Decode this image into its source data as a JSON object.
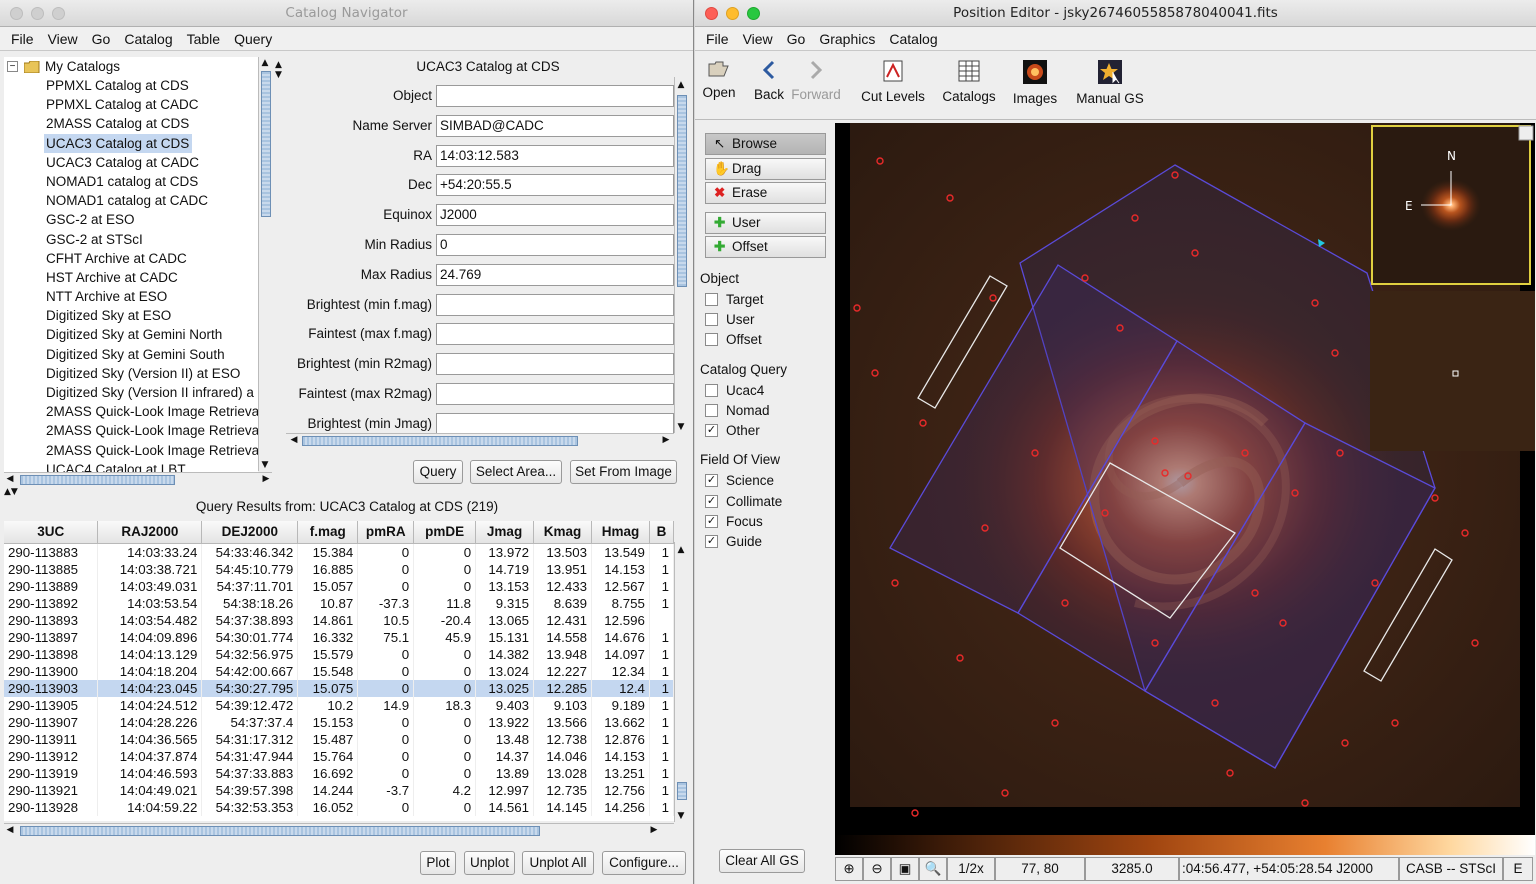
{
  "left_window": {
    "title": "Catalog Navigator",
    "menu": [
      "File",
      "View",
      "Go",
      "Catalog",
      "Table",
      "Query"
    ],
    "tree": {
      "root": "My Catalogs",
      "items": [
        "PPMXL Catalog at CDS",
        "PPMXL Catalog at CADC",
        "2MASS Catalog at CDS",
        "UCAC3 Catalog at CDS",
        "UCAC3 Catalog at CADC",
        "NOMAD1 catalog at CDS",
        "NOMAD1 catalog at CADC",
        "GSC-2 at ESO",
        "GSC-2 at STScI",
        "CFHT Archive at CADC",
        "HST Archive at CADC",
        "NTT Archive at ESO",
        "Digitized Sky at ESO",
        "Digitized Sky at Gemini North",
        "Digitized Sky at Gemini South",
        "Digitized Sky (Version II) at ESO",
        "Digitized Sky (Version II infrared) a",
        "2MASS Quick-Look Image Retrieva",
        "2MASS Quick-Look Image Retrieva",
        "2MASS Quick-Look Image Retrieva",
        "UCAC4 Catalog at LBT"
      ],
      "selected_index": 3
    },
    "form": {
      "title": "UCAC3 Catalog at CDS",
      "fields": [
        {
          "label": "Object",
          "value": ""
        },
        {
          "label": "Name Server",
          "value": "SIMBAD@CADC"
        },
        {
          "label": "RA",
          "value": "14:03:12.583"
        },
        {
          "label": "Dec",
          "value": "+54:20:55.5"
        },
        {
          "label": "Equinox",
          "value": "J2000"
        },
        {
          "label": "Min Radius",
          "value": "0"
        },
        {
          "label": "Max Radius",
          "value": "24.769"
        },
        {
          "label": "Brightest (min f.mag)",
          "value": ""
        },
        {
          "label": "Faintest (max f.mag)",
          "value": ""
        },
        {
          "label": "Brightest (min R2mag)",
          "value": ""
        },
        {
          "label": "Faintest (max R2mag)",
          "value": ""
        },
        {
          "label": "Brightest (min Jmag)",
          "value": ""
        }
      ],
      "buttons": {
        "query": "Query",
        "select_area": "Select Area...",
        "set_from_image": "Set From Image"
      }
    },
    "results": {
      "title": "Query Results from: UCAC3 Catalog at CDS (219)",
      "columns": [
        "3UC",
        "RAJ2000",
        "DEJ2000",
        "f.mag",
        "pmRA",
        "pmDE",
        "Jmag",
        "Kmag",
        "Hmag",
        "B"
      ],
      "rows": [
        [
          "290-113883",
          "14:03:33.24",
          "54:33:46.342",
          "15.384",
          "0",
          "0",
          "13.972",
          "13.503",
          "13.549",
          "1"
        ],
        [
          "290-113885",
          "14:03:38.721",
          "54:45:10.779",
          "16.885",
          "0",
          "0",
          "14.719",
          "13.951",
          "14.153",
          "1"
        ],
        [
          "290-113889",
          "14:03:49.031",
          "54:37:11.701",
          "15.057",
          "0",
          "0",
          "13.153",
          "12.433",
          "12.567",
          "1"
        ],
        [
          "290-113892",
          "14:03:53.54",
          "54:38:18.26",
          "10.87",
          "-37.3",
          "11.8",
          "9.315",
          "8.639",
          "8.755",
          "1"
        ],
        [
          "290-113893",
          "14:03:54.482",
          "54:37:38.893",
          "14.861",
          "10.5",
          "-20.4",
          "13.065",
          "12.431",
          "12.596",
          ""
        ],
        [
          "290-113897",
          "14:04:09.896",
          "54:30:01.774",
          "16.332",
          "75.1",
          "45.9",
          "15.131",
          "14.558",
          "14.676",
          "1"
        ],
        [
          "290-113898",
          "14:04:13.129",
          "54:32:56.975",
          "15.579",
          "0",
          "0",
          "14.382",
          "13.948",
          "14.097",
          "1"
        ],
        [
          "290-113900",
          "14:04:18.204",
          "54:42:00.667",
          "15.548",
          "0",
          "0",
          "13.024",
          "12.227",
          "12.34",
          "1"
        ],
        [
          "290-113903",
          "14:04:23.045",
          "54:30:27.795",
          "15.075",
          "0",
          "0",
          "13.025",
          "12.285",
          "12.4",
          "1"
        ],
        [
          "290-113905",
          "14:04:24.512",
          "54:39:12.472",
          "10.2",
          "14.9",
          "18.3",
          "9.403",
          "9.103",
          "9.189",
          "1"
        ],
        [
          "290-113907",
          "14:04:28.226",
          "54:37:37.4",
          "15.153",
          "0",
          "0",
          "13.922",
          "13.566",
          "13.662",
          "1"
        ],
        [
          "290-113911",
          "14:04:36.565",
          "54:31:17.312",
          "15.487",
          "0",
          "0",
          "13.48",
          "12.738",
          "12.876",
          "1"
        ],
        [
          "290-113912",
          "14:04:37.874",
          "54:31:47.944",
          "15.764",
          "0",
          "0",
          "14.37",
          "14.046",
          "14.153",
          "1"
        ],
        [
          "290-113919",
          "14:04:46.593",
          "54:37:33.883",
          "16.692",
          "0",
          "0",
          "13.89",
          "13.028",
          "13.251",
          "1"
        ],
        [
          "290-113921",
          "14:04:49.021",
          "54:39:57.398",
          "14.244",
          "-3.7",
          "4.2",
          "12.997",
          "12.735",
          "12.756",
          "1"
        ],
        [
          "290-113928",
          "14:04:59.22",
          "54:32:53.353",
          "16.052",
          "0",
          "0",
          "14.561",
          "14.145",
          "14.256",
          "1"
        ]
      ],
      "selected_row": 8
    },
    "bottom_buttons": {
      "plot": "Plot",
      "unplot": "Unplot",
      "unplot_all": "Unplot All",
      "configure": "Configure..."
    }
  },
  "right_window": {
    "title": "Position Editor - jsky2674605585878040041.fits",
    "menu": [
      "File",
      "View",
      "Go",
      "Graphics",
      "Catalog"
    ],
    "toolbar": {
      "open": "Open",
      "back": "Back",
      "forward": "Forward",
      "cut_levels": "Cut Levels",
      "catalogs": "Catalogs",
      "images": "Images",
      "manual_gs": "Manual GS"
    },
    "modes": {
      "browse": "Browse",
      "drag": "Drag",
      "erase": "Erase",
      "user": "User",
      "offset": "Offset"
    },
    "object_group": {
      "title": "Object",
      "target": "Target",
      "user": "User",
      "offset": "Offset"
    },
    "catalog_query_group": {
      "title": "Catalog Query",
      "ucac4": "Ucac4",
      "nomad": "Nomad",
      "other": "Other",
      "other_checked": true
    },
    "fov_group": {
      "title": "Field Of View",
      "science": "Science",
      "collimate": "Collimate",
      "focus": "Focus",
      "guide": "Guide",
      "all_checked": true
    },
    "compass": {
      "north": "N",
      "east": "E"
    },
    "clear_all_gs": "Clear All GS",
    "status": {
      "zoom": "1/2x",
      "pixel": "77, 80",
      "value": "3285.0",
      "coords": ":04:56.477, +54:05:28.54 J2000",
      "system": "CASB -- STScI",
      "extra": "E"
    }
  }
}
